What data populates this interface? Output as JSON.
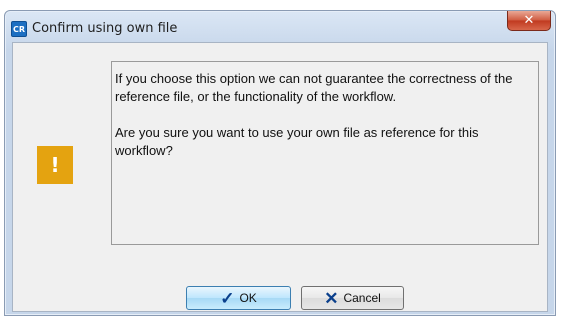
{
  "window": {
    "app_icon": "CR",
    "title": "Confirm using own file",
    "close_icon": "close-icon"
  },
  "dialog": {
    "warning_icon_glyph": "!",
    "warning_icon_color": "#e4a310",
    "message_paragraphs": [
      "If you choose this option we can not guarantee the correctness of the reference file, or the functionality of the workflow.",
      "Are you sure you want to use your own file as reference for this workflow?"
    ]
  },
  "buttons": {
    "ok_label": "OK",
    "cancel_label": "Cancel"
  }
}
